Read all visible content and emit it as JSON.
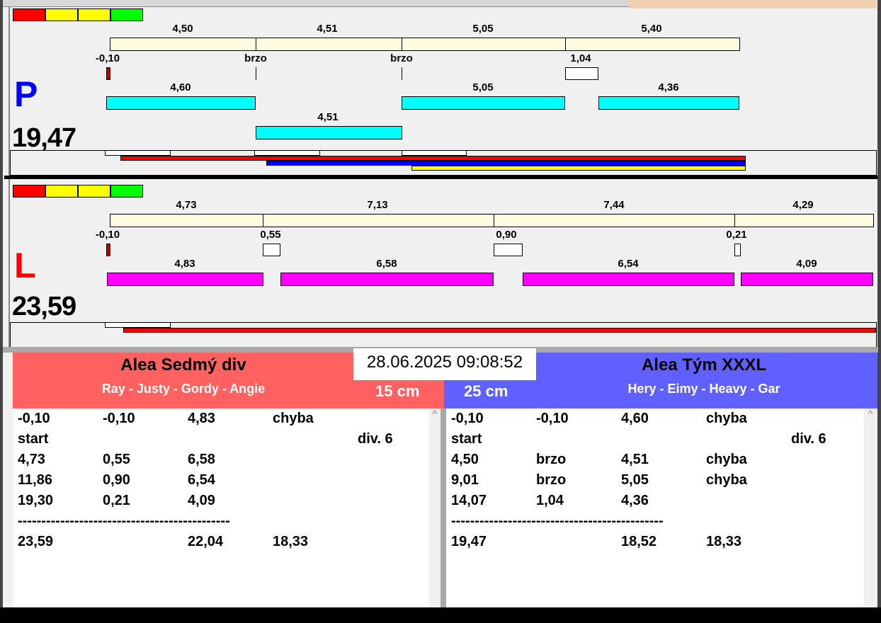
{
  "P": {
    "letter": "P",
    "total": "19,47",
    "top_labels": [
      "4,50",
      "4,51",
      "5,05",
      "5,40"
    ],
    "mid_labels": [
      "-0,10",
      "brzo",
      "brzo",
      "1,04"
    ],
    "bar_labels": [
      "4,60",
      "5,05",
      "4,36"
    ],
    "second_row_label": "4,51"
  },
  "L": {
    "letter": "L",
    "total": "23,59",
    "top_labels": [
      "4,73",
      "7,13",
      "7,44",
      "4,29"
    ],
    "mid_labels": [
      "-0,10",
      "0,55",
      "0,90",
      "0,21"
    ],
    "bar_labels": [
      "4,83",
      "6,58",
      "6,54",
      "4,09"
    ]
  },
  "datetime": "28.06.2025 09:08:52",
  "left_team": {
    "name": "Alea Sedmý div",
    "members": "Ray - Justy - Gordy - Angie",
    "distance": "15 cm",
    "rows": [
      [
        "-0,10",
        "-0,10",
        "4,83",
        "chyba",
        ""
      ],
      [
        "start",
        "",
        "",
        "",
        "div.  6"
      ],
      [
        "4,73",
        "0,55",
        "6,58",
        "",
        ""
      ],
      [
        "11,86",
        "0,90",
        "6,54",
        "",
        ""
      ],
      [
        "19,30",
        "0,21",
        "4,09",
        "",
        ""
      ],
      [
        "---------------------------------------------",
        "",
        "",
        "",
        ""
      ],
      [
        "23,59",
        "",
        "22,04",
        "18,33",
        ""
      ]
    ]
  },
  "right_team": {
    "name": "Alea Tým XXXL",
    "members": "Hery - Eimy - Heavy - Gar",
    "distance": "25 cm",
    "rows": [
      [
        "-0,10",
        "-0,10",
        "4,60",
        "chyba",
        ""
      ],
      [
        "start",
        "",
        "",
        "",
        "div.  6"
      ],
      [
        "4,50",
        "brzo",
        "4,51",
        "chyba",
        ""
      ],
      [
        "9,01",
        "brzo",
        "5,05",
        "chyba",
        ""
      ],
      [
        "14,07",
        "1,04",
        "4,36",
        "",
        ""
      ],
      [
        "---------------------------------------------",
        "",
        "",
        "",
        ""
      ],
      [
        "19,47",
        "",
        "18,52",
        "18,33",
        ""
      ]
    ]
  },
  "colors": {
    "left_header": "#ff6060",
    "right_header": "#6060ff",
    "p_letter": "#0000ff",
    "l_letter": "#ff0000"
  }
}
